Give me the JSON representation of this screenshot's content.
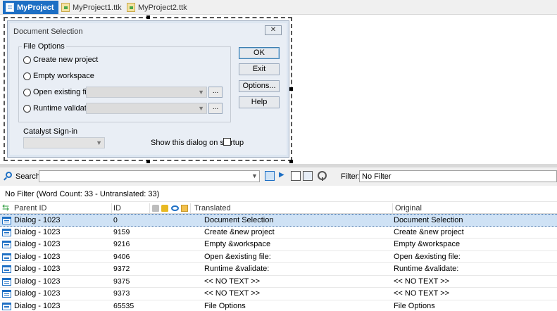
{
  "tabs": [
    {
      "label": "MyProject",
      "active": true
    },
    {
      "label": "MyProject1.ttk",
      "active": false
    },
    {
      "label": "MyProject2.ttk",
      "active": false
    }
  ],
  "dialog": {
    "title": "Document Selection",
    "close_label": "✕",
    "file_options_label": "File Options",
    "radios": [
      {
        "label": "Create new project"
      },
      {
        "label": "Empty workspace"
      },
      {
        "label": "Open existing file:"
      },
      {
        "label": "Runtime validate:"
      }
    ],
    "browse_label": "...",
    "buttons": {
      "ok": "OK",
      "exit": "Exit",
      "options": "Options...",
      "help": "Help"
    },
    "catalyst_label": "Catalyst Sign-in",
    "startup_label": "Show this dialog on startup"
  },
  "search": {
    "label": "Search:",
    "value": "",
    "filter_label": "Filter:",
    "filter_value": "No Filter"
  },
  "status": "No Filter (Word Count: 33 - Untranslated: 33)",
  "grid": {
    "columns": {
      "parent": "Parent ID",
      "id": "ID",
      "translated": "Translated",
      "original": "Original"
    },
    "rows": [
      {
        "parent": "Dialog - 1023",
        "id": "0",
        "translated": "Document Selection",
        "original": "Document Selection",
        "selected": true
      },
      {
        "parent": "Dialog - 1023",
        "id": "9159",
        "translated": "Create &new project",
        "original": "Create &new project",
        "selected": false
      },
      {
        "parent": "Dialog - 1023",
        "id": "9216",
        "translated": "Empty &workspace",
        "original": "Empty &workspace",
        "selected": false
      },
      {
        "parent": "Dialog - 1023",
        "id": "9406",
        "translated": "Open &existing file:",
        "original": "Open &existing file:",
        "selected": false
      },
      {
        "parent": "Dialog - 1023",
        "id": "9372",
        "translated": "Runtime &validate:",
        "original": "Runtime &validate:",
        "selected": false
      },
      {
        "parent": "Dialog - 1023",
        "id": "9375",
        "translated": "<< NO TEXT >>",
        "original": "<< NO TEXT >>",
        "selected": false
      },
      {
        "parent": "Dialog - 1023",
        "id": "9373",
        "translated": "<< NO TEXT >>",
        "original": "<< NO TEXT >>",
        "selected": false
      },
      {
        "parent": "Dialog - 1023",
        "id": "65535",
        "translated": "File Options",
        "original": "File Options",
        "selected": false
      }
    ]
  },
  "colors": {
    "accent": "#1d6fc4",
    "selected_row": "#cfe2f5",
    "dialog_bg": "#e9eef5"
  },
  "icons": [
    "project-icon",
    "file-icon",
    "close-icon",
    "search-icon",
    "refresh-icon",
    "lock-icon",
    "eye-icon",
    "folder-icon",
    "dialog-row-icon"
  ]
}
